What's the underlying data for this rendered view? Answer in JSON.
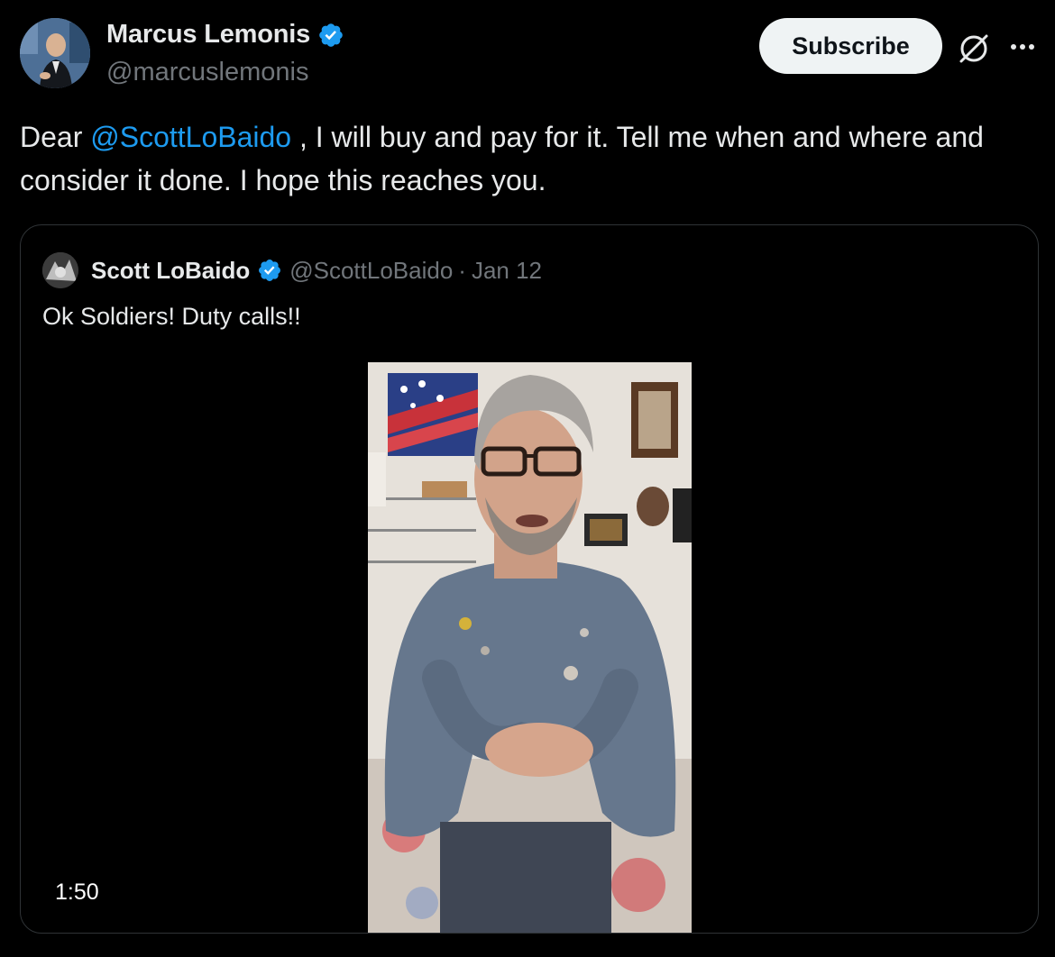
{
  "author": {
    "display_name": "Marcus Lemonis",
    "handle": "@marcuslemonis",
    "verified": true
  },
  "actions": {
    "subscribe_label": "Subscribe",
    "grok_icon": "grok-icon",
    "more_icon": "more-icon"
  },
  "tweet": {
    "text_before": "Dear ",
    "mention": "@ScottLoBaido",
    "text_after": " , I will buy and pay for it. Tell me when and where and consider it done. I hope this reaches you."
  },
  "quote": {
    "display_name": "Scott LoBaido",
    "handle": "@ScottLoBaido",
    "separator": "·",
    "date": "Jan 12",
    "verified": true,
    "text": "Ok Soldiers! Duty calls!!",
    "video": {
      "duration": "1:50"
    }
  },
  "colors": {
    "background": "#000000",
    "text": "#e7e9ea",
    "secondary_text": "#71767b",
    "link": "#1d9bf0",
    "verified_badge": "#1d9bf0",
    "border": "#2f3336"
  }
}
